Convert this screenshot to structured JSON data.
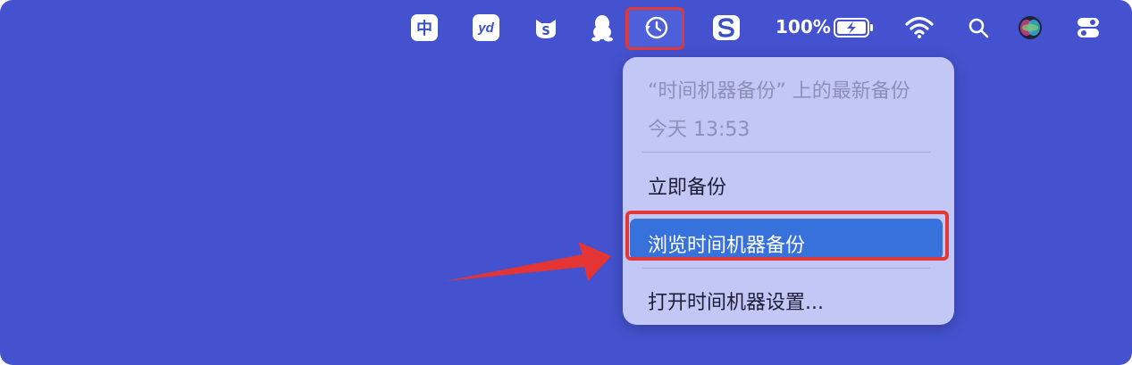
{
  "menubar": {
    "input_method": "中",
    "youdao": "yd",
    "cat_app": "S",
    "battery_percent": "100%",
    "icons": [
      "input-method-icon",
      "youdao-icon",
      "cat-app-icon",
      "qq-penguin-icon",
      "time-machine-icon",
      "s-app-icon",
      "battery-icon",
      "wifi-icon",
      "search-icon",
      "siri-icon",
      "control-center-icon"
    ]
  },
  "time_machine_menu": {
    "header_title": "“时间机器备份” 上的最新备份",
    "header_time": "今天 13:53",
    "items": [
      {
        "label": "立即备份"
      },
      {
        "label": "浏览时间机器备份"
      },
      {
        "label": "打开时间机器设置..."
      }
    ]
  },
  "colors": {
    "desktop": "#4452cf",
    "highlight": "#e23838",
    "selection": "#3772dc",
    "menu": "#c3c7f5"
  }
}
